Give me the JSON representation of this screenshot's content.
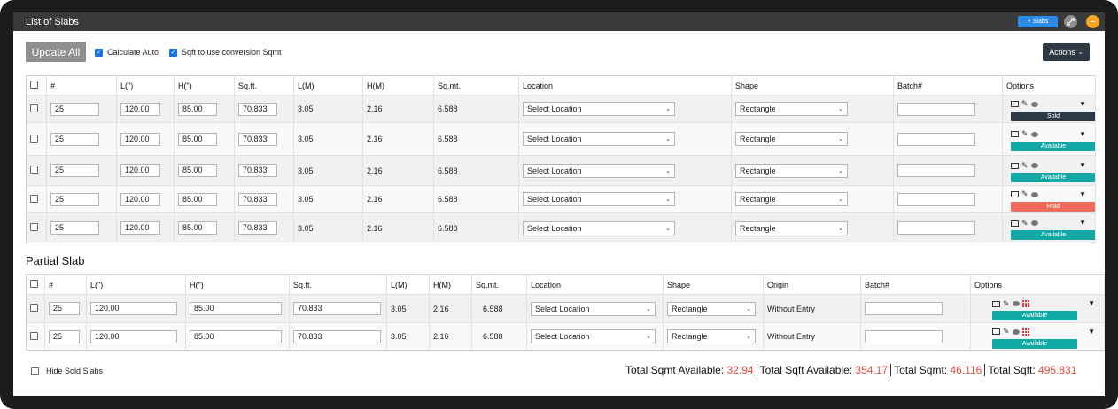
{
  "window": {
    "title": "List of Slabs",
    "add_slabs_label": "+ Slabs",
    "min_label": "–"
  },
  "toolbar": {
    "update_all_label": "Update All",
    "calc_auto_label": "Calculate Auto",
    "sqft_conversion_label": "Sqft to use conversion Sqmt",
    "actions_label": "Actions"
  },
  "slabs_table": {
    "headers": [
      "#",
      "L(\")",
      "H(\")",
      "Sq.ft.",
      "L(M)",
      "H(M)",
      "Sq.mt.",
      "Location",
      "Shape",
      "Batch#",
      "Options"
    ],
    "rows": [
      {
        "num": "25",
        "l_in": "120.00",
        "h_in": "85.00",
        "sqft": "70.833",
        "l_m": "3.05",
        "h_m": "2.16",
        "sqmt": "6.588",
        "location": "Select Location",
        "shape": "Rectangle",
        "batch": "",
        "status": "Sold"
      },
      {
        "num": "25",
        "l_in": "120.00",
        "h_in": "85.00",
        "sqft": "70.833",
        "l_m": "3.05",
        "h_m": "2.16",
        "sqmt": "6.588",
        "location": "Select Location",
        "shape": "Rectangle",
        "batch": "",
        "status": "Available"
      },
      {
        "num": "25",
        "l_in": "120.00",
        "h_in": "85.00",
        "sqft": "70.833",
        "l_m": "3.05",
        "h_m": "2.16",
        "sqmt": "6.588",
        "location": "Select Location",
        "shape": "Rectangle",
        "batch": "",
        "status": "Available"
      },
      {
        "num": "25",
        "l_in": "120.00",
        "h_in": "85.00",
        "sqft": "70.833",
        "l_m": "3.05",
        "h_m": "2.16",
        "sqmt": "6.588",
        "location": "Select Location",
        "shape": "Rectangle",
        "batch": "",
        "status": "Hold"
      },
      {
        "num": "25",
        "l_in": "120.00",
        "h_in": "85.00",
        "sqft": "70.833",
        "l_m": "3.05",
        "h_m": "2.16",
        "sqmt": "6.588",
        "location": "Select Location",
        "shape": "Rectangle",
        "batch": "",
        "status": "Available"
      }
    ]
  },
  "partial": {
    "title": "Partial Slab",
    "headers": [
      "#",
      "L(\")",
      "H(\")",
      "Sq.ft.",
      "L(M)",
      "H(M)",
      "Sq.mt.",
      "Location",
      "Shape",
      "Origin",
      "Batch#",
      "Options"
    ],
    "rows": [
      {
        "num": "25",
        "l_in": "120.00",
        "h_in": "85.00",
        "sqft": "70.833",
        "l_m": "3.05",
        "h_m": "2.16",
        "sqmt": "6.588",
        "location": "Select Location",
        "shape": "Rectangle",
        "origin": "Without Entry",
        "batch": "",
        "status": "Available"
      },
      {
        "num": "25",
        "l_in": "120.00",
        "h_in": "85.00",
        "sqft": "70.833",
        "l_m": "3.05",
        "h_m": "2.16",
        "sqmt": "6.588",
        "location": "Select Location",
        "shape": "Rectangle",
        "origin": "Without Entry",
        "batch": "",
        "status": "Available"
      }
    ]
  },
  "footer": {
    "hide_sold_label": "Hide Sold Slabs",
    "totals": [
      {
        "label": "Total Sqmt Available:",
        "value": "32.94"
      },
      {
        "label": "Total Sqft Available:",
        "value": "354.17"
      },
      {
        "label": "Total Sqmt:",
        "value": "46.116"
      },
      {
        "label": "Total Sqft:",
        "value": "495.831"
      }
    ]
  },
  "colors": {
    "sold": "#2d3a45",
    "available": "#11a8a5",
    "hold": "#f26b5b",
    "accent": "#2e8be6",
    "total_value": "#e84a3c"
  }
}
